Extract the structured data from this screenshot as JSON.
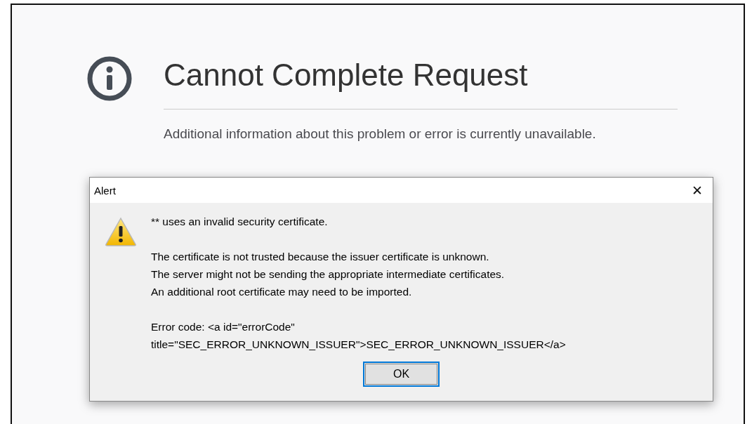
{
  "page": {
    "title": "Cannot Complete Request",
    "description": "Additional information about this problem or error is currently unavailable."
  },
  "alert": {
    "title": "Alert",
    "close": "✕",
    "heading": "** uses an invalid security certificate.",
    "paragraphs": [
      [
        "The certificate is not trusted because the issuer certificate is unknown.",
        "The server might not be sending the appropriate intermediate certificates.",
        "An additional root certificate may need to be imported."
      ],
      [
        "Error code: <a id=\"errorCode\"",
        "title=\"SEC_ERROR_UNKNOWN_ISSUER\">SEC_ERROR_UNKNOWN_ISSUER</a>"
      ]
    ],
    "button": "OK"
  }
}
